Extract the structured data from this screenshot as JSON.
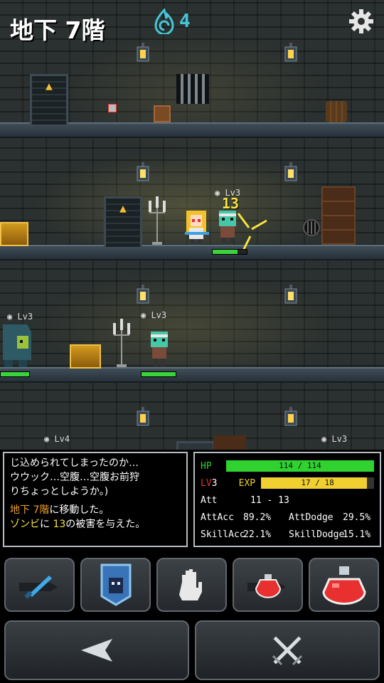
{
  "header": {
    "floor_label": "地下 7階",
    "soul_count": "4"
  },
  "units": {
    "zombie_top_level": "Lv3",
    "damage_popup": "13",
    "golem_level": "Lv3",
    "zombie_mid_level": "Lv3",
    "bottom_left_level": "Lv4",
    "bottom_right_level": "Lv3"
  },
  "log": {
    "line1": "じ込められてしまったのか…",
    "line2": "ウウック…空腹…空腹お前狩",
    "line3": "りちょっとしようか。)",
    "move_a": "地下 ",
    "move_floor": "7階",
    "move_b": "に移動した。",
    "dmg_target": "ゾンビ",
    "dmg_a": "に ",
    "dmg_value": "13",
    "dmg_b": "の被害を与えた。"
  },
  "stats": {
    "hp_label": "HP",
    "hp_text": "114 / 114",
    "hp_ratio": 1.0,
    "lv_label": "LV",
    "lv_value": "3",
    "exp_label": "EXP",
    "exp_text": "17 / 18",
    "exp_ratio": 0.94,
    "att_label": "Att",
    "att_value": "11 - 13",
    "attacc_label": "AttAcc",
    "attacc_value": "89.2%",
    "attdodge_label": "AttDodge",
    "attdodge_value": "29.5%",
    "skillacc_label": "SkillAcc",
    "skillacc_value": "22.1%",
    "skilldodge_label": "SkillDodge",
    "skilldodge_value": "15.1%"
  },
  "colors": {
    "hp": "#2fd22f",
    "exp": "#f0d030",
    "lv": "#e03030",
    "accent": "#45c6d8"
  }
}
